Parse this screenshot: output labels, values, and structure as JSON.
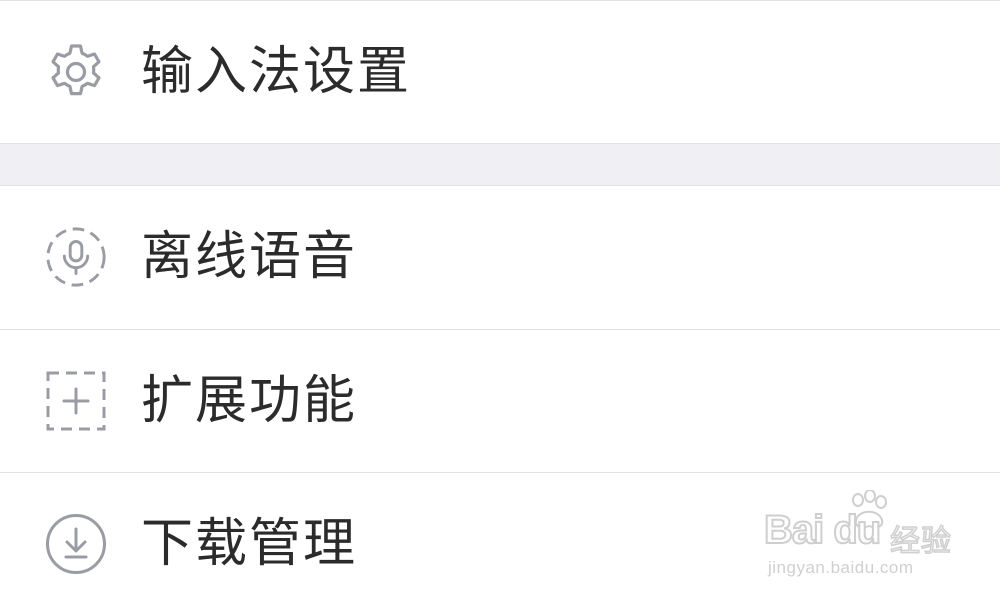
{
  "menu": {
    "items": [
      {
        "label": "输入法设置",
        "icon": "gear-icon"
      },
      {
        "label": "离线语音",
        "icon": "microphone-dashed-circle-icon"
      },
      {
        "label": "扩展功能",
        "icon": "plus-dashed-square-icon"
      },
      {
        "label": "下载管理",
        "icon": "download-circle-icon"
      }
    ]
  },
  "watermark": {
    "brand": "Bai du",
    "brand_cn": "经验",
    "url": "jingyan.baidu.com"
  },
  "colors": {
    "background": "#ffffff",
    "section_gap": "#efeff4",
    "divider": "#e2e2e6",
    "icon": "#9a9ca3",
    "text": "#2b2b2b"
  }
}
